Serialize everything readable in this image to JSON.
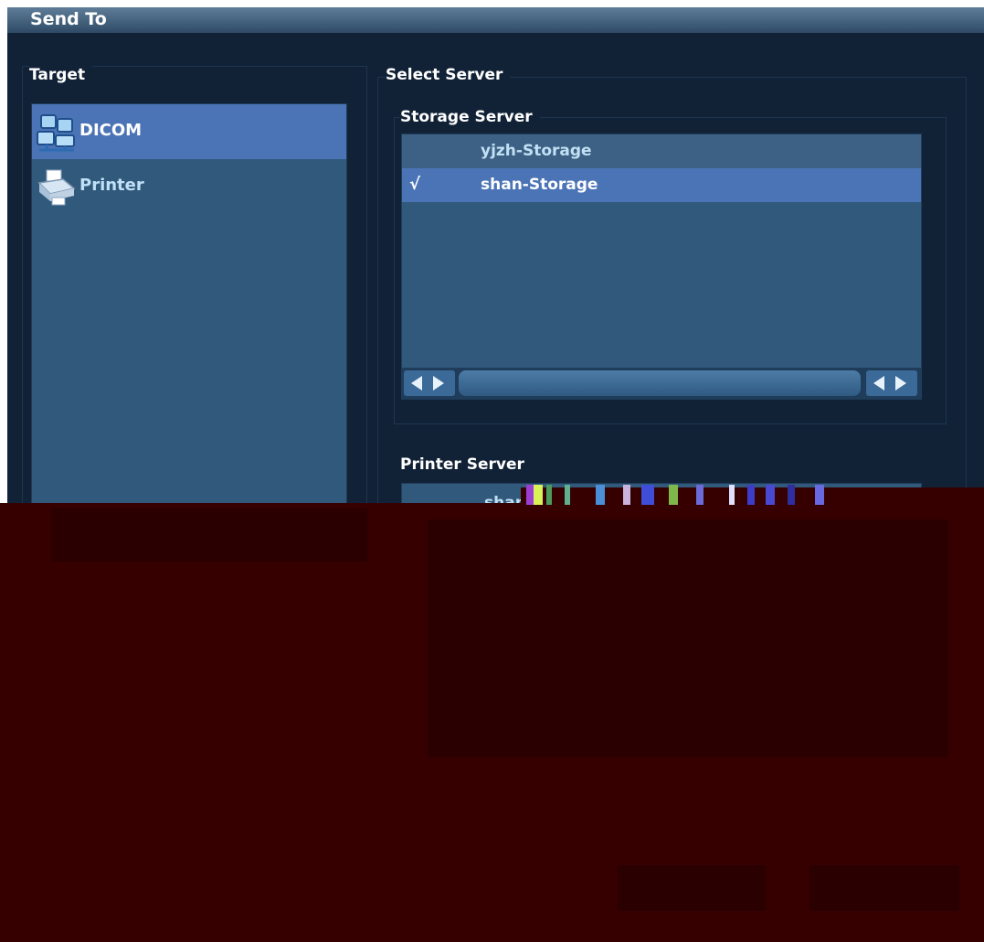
{
  "window": {
    "title": "Send To"
  },
  "target": {
    "title": "Target",
    "items": [
      {
        "label": "DICOM",
        "icon": "dicom-network-icon",
        "selected": true
      },
      {
        "label": "Printer",
        "icon": "printer-icon",
        "selected": false
      }
    ]
  },
  "select_server": {
    "title": "Select Server",
    "storage": {
      "title": "Storage Server",
      "rows": [
        {
          "check": "",
          "name": "yjzh-Storage"
        },
        {
          "check": "√",
          "name": "shan-Storage"
        }
      ]
    },
    "printer": {
      "title": "Printer Server",
      "rows": [
        {
          "name": "shan"
        }
      ]
    }
  },
  "colors": {
    "dialog_bg": "#112236",
    "list_bg": "#31597c",
    "selection": "#4b74b6",
    "corrupt_overlay": "#360000"
  }
}
